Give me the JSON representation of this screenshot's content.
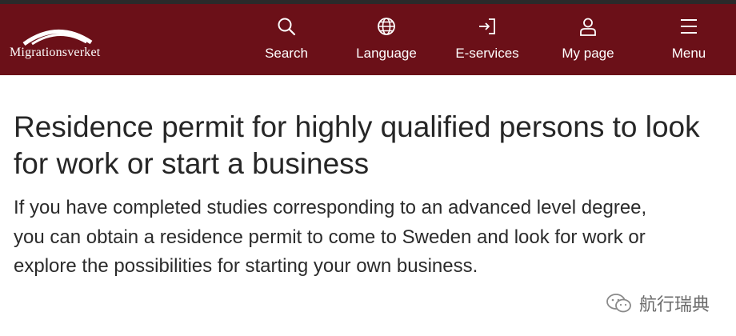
{
  "brand": {
    "name": "Migrationsverket"
  },
  "nav": {
    "items": [
      {
        "label": "Search",
        "icon": "search-icon"
      },
      {
        "label": "Language",
        "icon": "globe-icon"
      },
      {
        "label": "E-services",
        "icon": "sign-in-icon"
      },
      {
        "label": "My page",
        "icon": "user-icon"
      },
      {
        "label": "Menu",
        "icon": "hamburger-menu-icon"
      }
    ]
  },
  "main": {
    "title": "Residence permit for highly qualified persons to look for work or start a business",
    "intro": "If you have completed studies corresponding to an advanced level degree, you can obtain a residence permit to come to Sweden and look for work or explore the possibilities for starting your own business."
  },
  "watermark": {
    "text": "航行瑞典"
  },
  "colors": {
    "header_bg": "#6b1018",
    "text": "#262626",
    "header_text": "#ffffff"
  }
}
